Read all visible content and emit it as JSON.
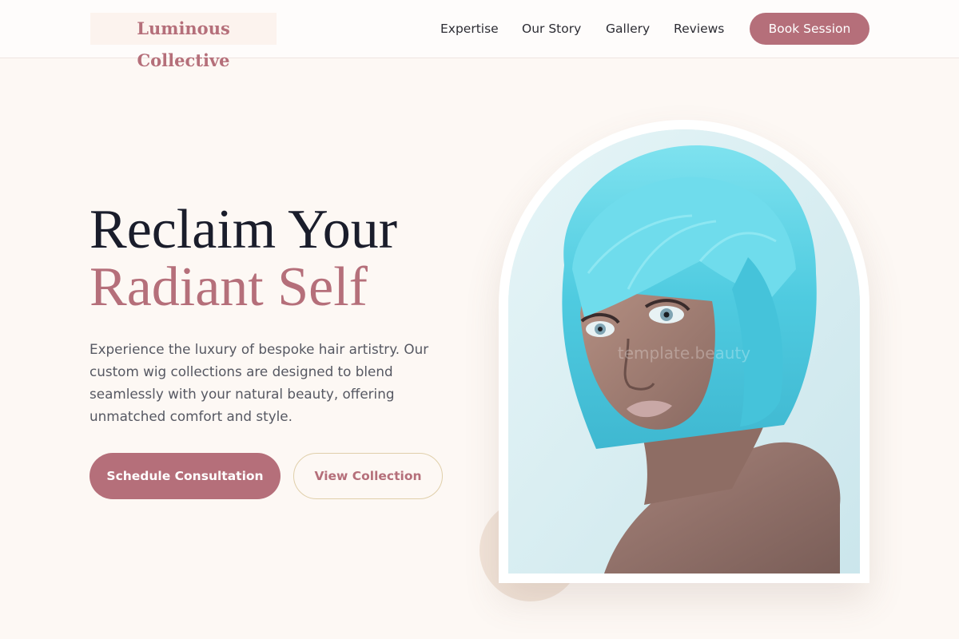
{
  "header": {
    "logo": "Luminous Collective",
    "nav": {
      "expertise": "Expertise",
      "story": "Our Story",
      "gallery": "Gallery",
      "reviews": "Reviews"
    },
    "cta": "Book Session"
  },
  "hero": {
    "headline_line1": "Reclaim Your",
    "headline_line2": "Radiant Self",
    "description": "Experience the luxury of bespoke hair artistry. Our custom wig collections are designed to blend seamlessly with your natural beauty, offering unmatched comfort and style.",
    "primary_cta": "Schedule Consultation",
    "secondary_cta": "View Collection",
    "image_watermark": "template.beauty"
  },
  "colors": {
    "accent": "#b56f7a",
    "headline_dark": "#1a1d2b",
    "background": "#fdf8f4",
    "outline_gold": "#e0cfaa",
    "hair_turquoise": "#5fd3e6"
  },
  "icons": {
    "hero_image": "portrait-photo"
  }
}
